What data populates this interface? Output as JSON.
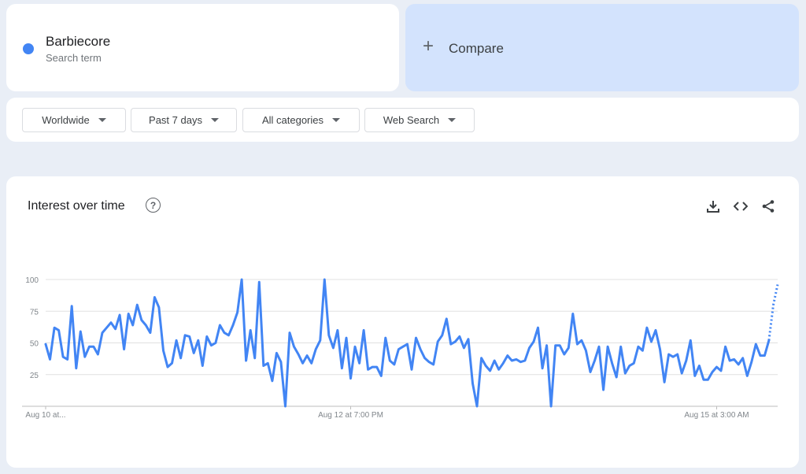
{
  "search_term": {
    "name": "Barbiecore",
    "subtitle": "Search term",
    "color": "#4285f4"
  },
  "compare": {
    "label": "Compare",
    "icon": "plus-icon"
  },
  "filters": {
    "region": "Worldwide",
    "time": "Past 7 days",
    "category": "All categories",
    "property": "Web Search"
  },
  "chart_header": {
    "title": "Interest over time",
    "help_icon": "?",
    "tools": [
      "download-icon",
      "embed-code-icon",
      "share-icon"
    ]
  },
  "chart_data": {
    "type": "line",
    "title": "Interest over time",
    "series": [
      {
        "name": "Barbiecore",
        "color": "#4285f4",
        "values": [
          49,
          37,
          62,
          60,
          39,
          37,
          79,
          30,
          59,
          39,
          47,
          47,
          41,
          58,
          62,
          66,
          61,
          72,
          45,
          73,
          64,
          80,
          68,
          64,
          58,
          86,
          78,
          44,
          31,
          34,
          52,
          38,
          56,
          55,
          42,
          52,
          32,
          55,
          48,
          50,
          64,
          58,
          56,
          64,
          74,
          100,
          36,
          60,
          38,
          98,
          32,
          34,
          20,
          42,
          35,
          0,
          58,
          47,
          41,
          34,
          40,
          34,
          45,
          52,
          100,
          56,
          46,
          60,
          30,
          54,
          22,
          47,
          34,
          60,
          29,
          31,
          31,
          24,
          54,
          36,
          33,
          45,
          47,
          49,
          29,
          54,
          45,
          38,
          35,
          33,
          51,
          56,
          69,
          49,
          51,
          55,
          46,
          53,
          18,
          0,
          38,
          32,
          28,
          36,
          29,
          34,
          40,
          36,
          37,
          35,
          36,
          46,
          51,
          62,
          30,
          48,
          0,
          48,
          48,
          41,
          46,
          73,
          49,
          52,
          44,
          27,
          36,
          47,
          13,
          47,
          34,
          23,
          47,
          26,
          32,
          34,
          47,
          44,
          62,
          51,
          60,
          45,
          19,
          41,
          39,
          41,
          26,
          36,
          52,
          24,
          32,
          21,
          21,
          27,
          31,
          28,
          47,
          36,
          37,
          33,
          38,
          24,
          35,
          49,
          40,
          40,
          52,
          80,
          96
        ],
        "partial_last": 2
      }
    ],
    "x_tick_labels": [
      "Aug 10 at...",
      "Aug 12 at 7:00 PM",
      "Aug 15 at 3:00 AM"
    ],
    "x_tick_positions": [
      0,
      70,
      154
    ],
    "y_ticks": [
      25,
      50,
      75,
      100
    ],
    "ylim": [
      0,
      100
    ],
    "grid": true
  }
}
